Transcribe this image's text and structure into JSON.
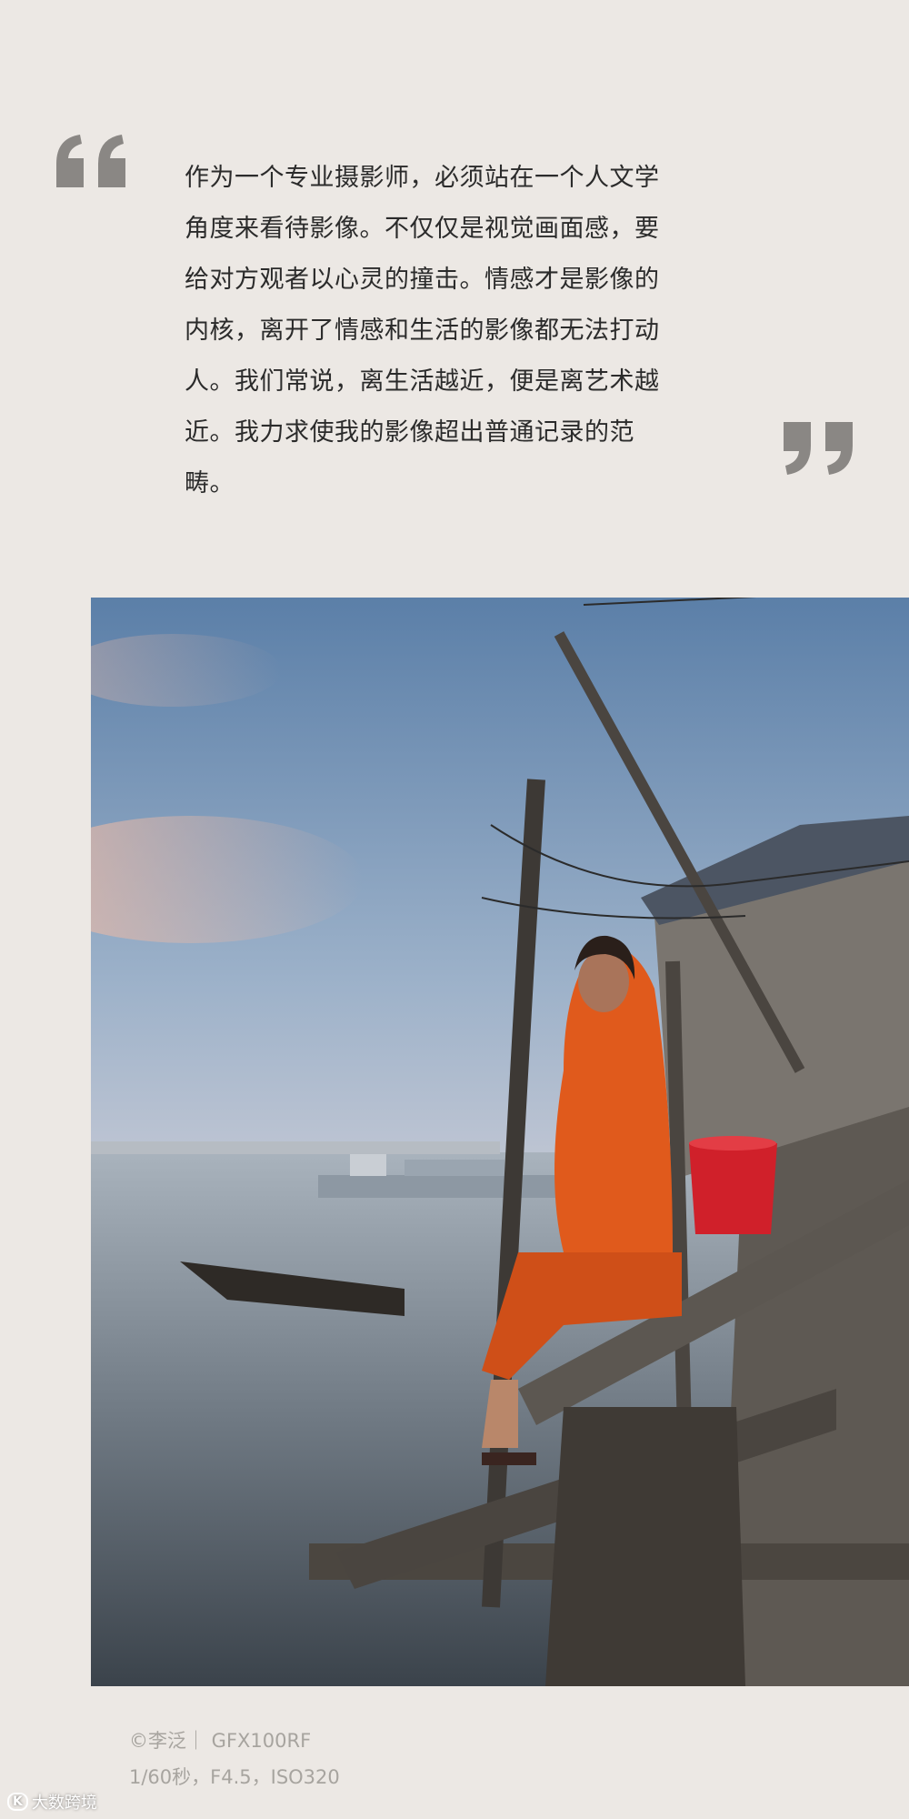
{
  "quote": {
    "lines": [
      "作为一个专业摄影师，必须站在一个人文学",
      "角度来看待影像。不仅仅是视觉画面感，要",
      "给对方观者以心灵的撞击。情感才是影像的",
      "内核，离开了情感和生活的影像都无法打动",
      "人。我们常说，离生活越近，便是离艺术越",
      "近。我力求使我的影像超出普通记录的范",
      "畴。"
    ],
    "open_icon": "open-quote-icon",
    "close_icon": "close-quote-icon"
  },
  "photo": {
    "icon": "photograph-girl-on-stilt-dock"
  },
  "caption": {
    "credit": "©李泛｜ GFX100RF",
    "settings": "1/60秒，F4.5，ISO320"
  },
  "watermark": {
    "logo": "K",
    "text": "大数跨境"
  },
  "colors": {
    "background": "#ece8e4",
    "quote_mark": "#8a8784",
    "text": "#2b2b2b",
    "caption": "#a7a49f",
    "sari": "#e05a1c",
    "bucket": "#d0202a"
  }
}
